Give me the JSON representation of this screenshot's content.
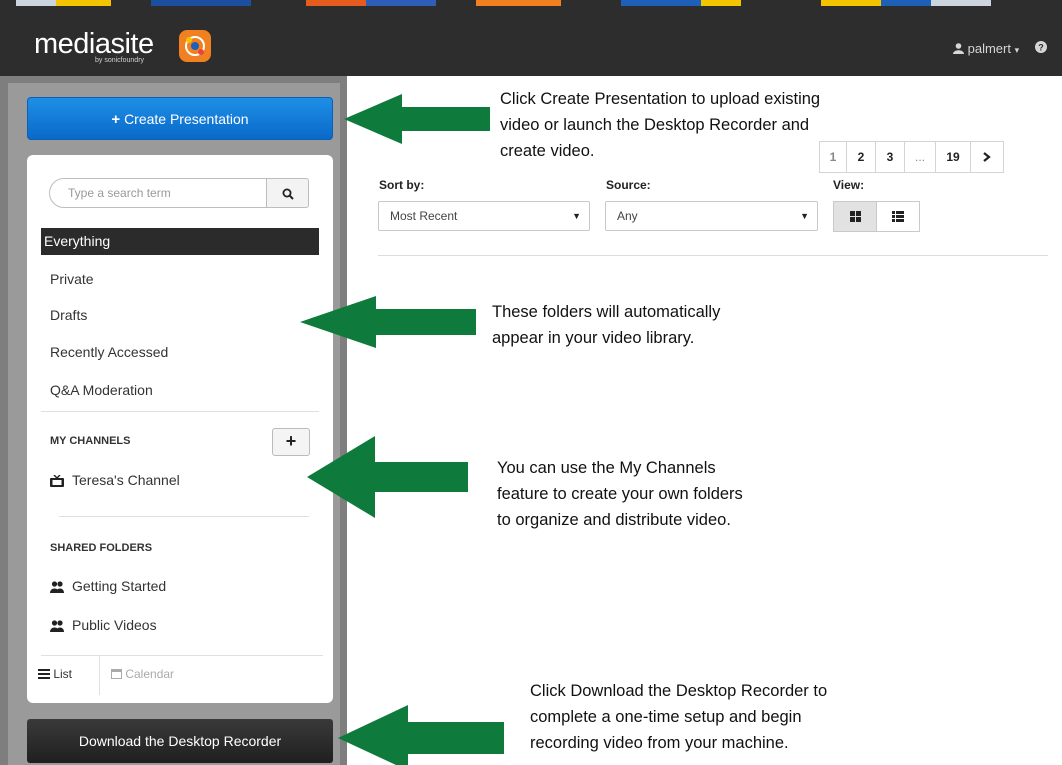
{
  "header": {
    "logo_text": "mediasite",
    "logo_sub": "by sonicfoundry",
    "user_name": "palmert",
    "help_label": "?"
  },
  "sidebar": {
    "create_button": "Create Presentation",
    "search_placeholder": "Type a search term",
    "nav": [
      "Everything",
      "Private",
      "Drafts",
      "Recently Accessed",
      "Q&A Moderation"
    ],
    "my_channels_title": "MY CHANNELS",
    "channels": [
      "Teresa's Channel"
    ],
    "shared_folders_title": "SHARED FOLDERS",
    "shared": [
      "Getting Started",
      "Public Videos"
    ],
    "tabs": [
      "List",
      "Calendar"
    ],
    "download_button": "Download the Desktop Recorder"
  },
  "main": {
    "pager": [
      "1",
      "2",
      "3",
      "...",
      "19"
    ],
    "sort_label": "Sort by:",
    "sort_value": "Most Recent",
    "source_label": "Source:",
    "source_value": "Any",
    "view_label": "View:"
  },
  "callouts": {
    "c1": [
      "Click Create Presentation to upload existing",
      "video or launch the Desktop Recorder and",
      "create video."
    ],
    "c2": [
      "These folders will automatically",
      "appear in your video library."
    ],
    "c3": [
      "You can use the My Channels",
      "feature to create your own folders",
      "to organize and distribute video."
    ],
    "c4": [
      "Click Download the Desktop Recorder to",
      "complete a one-time setup and begin",
      "recording video from your machine."
    ]
  },
  "colors": {
    "primary_button": "#0a69c9",
    "arrow": "#0e7a3b",
    "header": "#2d2d2d",
    "sidebar_bg": "#9a9a9a"
  }
}
